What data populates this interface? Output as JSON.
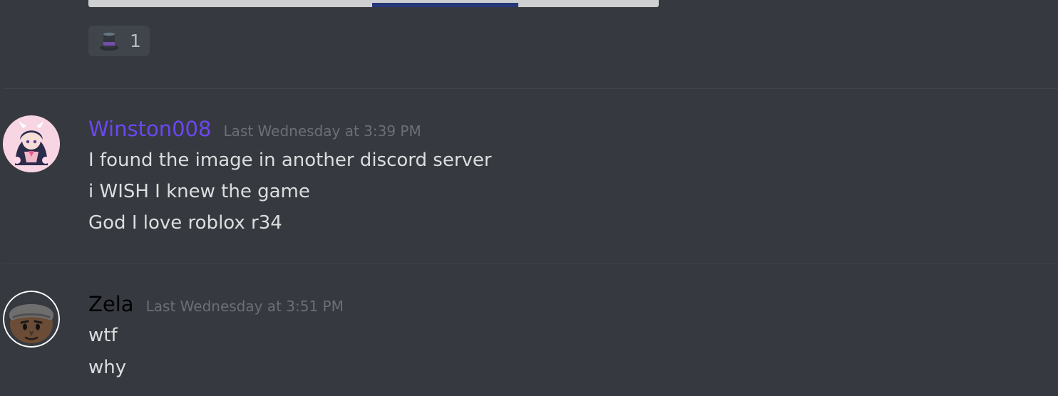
{
  "reaction": {
    "icon": "top-hat-icon",
    "count": "1"
  },
  "messages": [
    {
      "username": "Winston008",
      "username_color": "#6b47f2",
      "timestamp": "Last Wednesday at 3:39 PM",
      "avatar_icon": "anime-girl-avatar",
      "lines": [
        "I found the image in another discord server",
        "i WISH I knew the game",
        "God I love roblox r34"
      ]
    },
    {
      "username": "Zela",
      "username_color": "#000000",
      "timestamp": "Last Wednesday at 3:51 PM",
      "avatar_icon": "cartoon-face-avatar",
      "lines": [
        "wtf",
        "why"
      ]
    }
  ],
  "colors": {
    "background": "#36393f",
    "text": "#dcddde",
    "timestamp": "#6c6f75",
    "reaction_bg": "#40444b"
  }
}
